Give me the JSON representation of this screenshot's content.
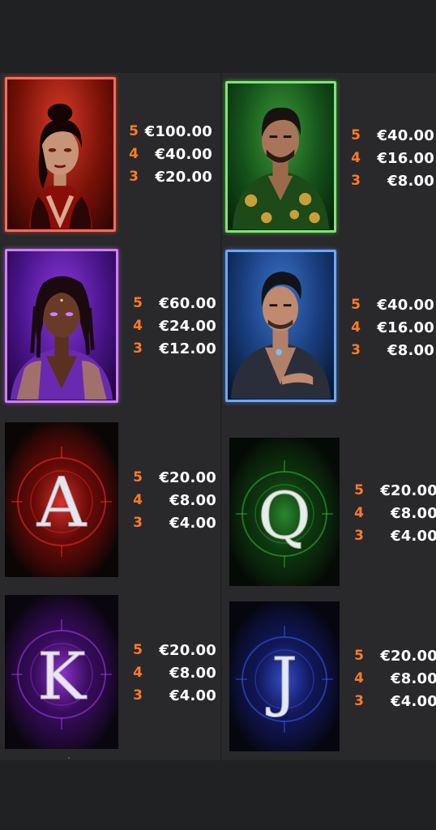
{
  "symbols": [
    {
      "id": "red-woman",
      "kind": "premium",
      "theme": "red",
      "color": "#ff6a55",
      "pays": [
        {
          "count": "5",
          "value": "€100.00"
        },
        {
          "count": "4",
          "value": "€40.00"
        },
        {
          "count": "3",
          "value": "€20.00"
        }
      ]
    },
    {
      "id": "green-man",
      "kind": "premium",
      "theme": "green",
      "color": "#7ae870",
      "pays": [
        {
          "count": "5",
          "value": "€40.00"
        },
        {
          "count": "4",
          "value": "€16.00"
        },
        {
          "count": "3",
          "value": "€8.00"
        }
      ]
    },
    {
      "id": "purple-woman",
      "kind": "premium",
      "theme": "purple",
      "color": "#d27cff",
      "pays": [
        {
          "count": "5",
          "value": "€60.00"
        },
        {
          "count": "4",
          "value": "€24.00"
        },
        {
          "count": "3",
          "value": "€12.00"
        }
      ]
    },
    {
      "id": "blue-man",
      "kind": "premium",
      "theme": "blue",
      "color": "#6aa8ff",
      "pays": [
        {
          "count": "5",
          "value": "€40.00"
        },
        {
          "count": "4",
          "value": "€16.00"
        },
        {
          "count": "3",
          "value": "€8.00"
        }
      ]
    },
    {
      "id": "ace",
      "kind": "royal",
      "letter": "A",
      "theme": "red",
      "color": "#ff2a2a",
      "pays": [
        {
          "count": "5",
          "value": "€20.00"
        },
        {
          "count": "4",
          "value": "€8.00"
        },
        {
          "count": "3",
          "value": "€4.00"
        }
      ]
    },
    {
      "id": "queen",
      "kind": "royal",
      "letter": "Q",
      "theme": "green",
      "color": "#38c040",
      "pays": [
        {
          "count": "5",
          "value": "€20.00"
        },
        {
          "count": "4",
          "value": "€8.00"
        },
        {
          "count": "3",
          "value": "€4.00"
        }
      ]
    },
    {
      "id": "king",
      "kind": "royal",
      "letter": "K",
      "theme": "purple",
      "color": "#b040ff",
      "pays": [
        {
          "count": "5",
          "value": "€20.00"
        },
        {
          "count": "4",
          "value": "€8.00"
        },
        {
          "count": "3",
          "value": "€4.00"
        }
      ]
    },
    {
      "id": "jack",
      "kind": "royal",
      "letter": "J",
      "theme": "blue",
      "color": "#4060ff",
      "pays": [
        {
          "count": "5",
          "value": "€20.00"
        },
        {
          "count": "4",
          "value": "€8.00"
        },
        {
          "count": "3",
          "value": "€4.00"
        }
      ]
    }
  ]
}
